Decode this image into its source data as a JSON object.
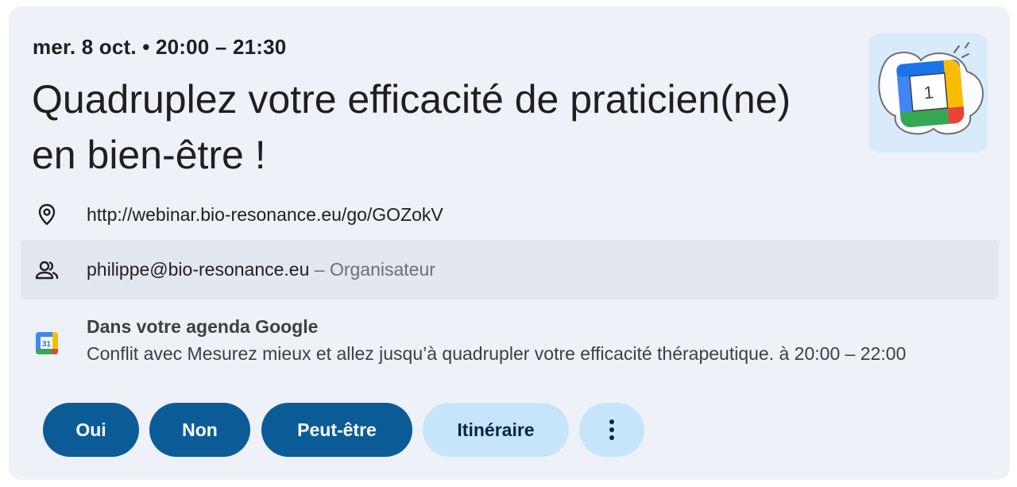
{
  "event": {
    "datetime": "mer. 8 oct. • 20:00 – 21:30",
    "title": "Quadruplez votre efficacité de praticien(ne) en bien-être !"
  },
  "location": {
    "icon": "location-pin-icon",
    "url": "http://webinar.bio-resonance.eu/go/GOZokV"
  },
  "organizer": {
    "icon": "people-icon",
    "email": "philippe@bio-resonance.eu",
    "role": "– Organisateur"
  },
  "calendar": {
    "icon": "google-calendar-icon",
    "icon_number": "31",
    "title": "Dans votre agenda Google",
    "conflict": "Conflit avec Mesurez mieux et allez jusqu’à quadrupler votre efficacité thérapeutique. à 20:00 – 22:00"
  },
  "hero": {
    "icon": "google-calendar-illustration-icon",
    "number": "1"
  },
  "actions": {
    "yes": "Oui",
    "no": "Non",
    "maybe": "Peut-être",
    "directions": "Itinéraire",
    "more_icon": "more-vert-icon"
  },
  "colors": {
    "card_bg": "#eef1f7",
    "primary_button": "#0b5c96",
    "secondary_button": "#c6e5fb",
    "google_blue": "#4285f4",
    "google_red": "#ea4335",
    "google_yellow": "#fbbc04",
    "google_green": "#34a853"
  }
}
